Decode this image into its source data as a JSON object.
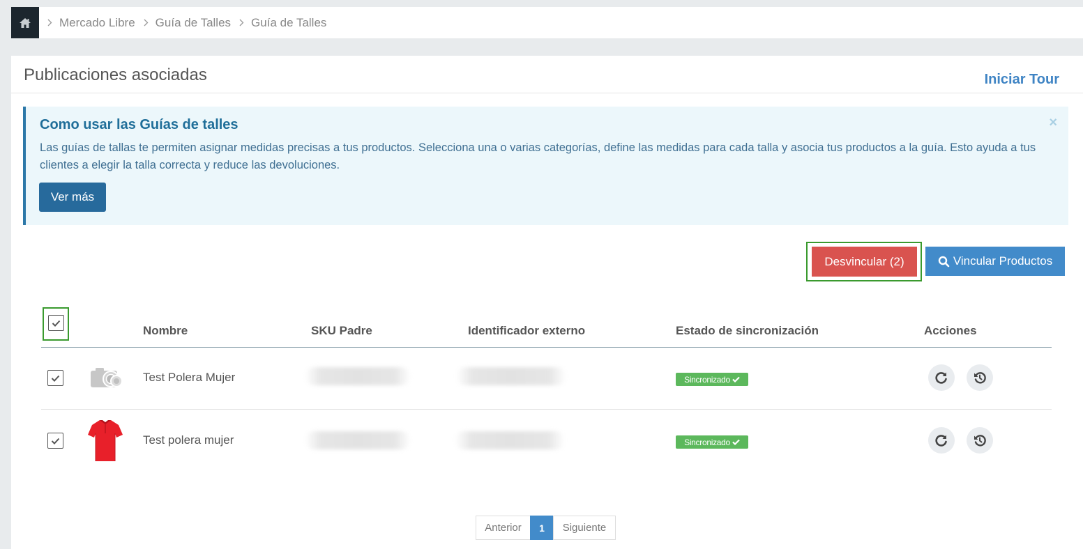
{
  "breadcrumb": {
    "home_icon": "home-icon",
    "items": [
      "Mercado Libre",
      "Guía de Talles",
      "Guía de Talles"
    ]
  },
  "panel": {
    "title": "Publicaciones asociadas",
    "tour_label": "Iniciar Tour"
  },
  "alert": {
    "title": "Como usar las Guías de talles",
    "body": "Las guías de tallas te permiten asignar medidas precisas a tus productos. Selecciona una o varias categorías, define las medidas para cada talla y asocia tus productos a la guía. Esto ayuda a tus clientes a elegir la talla correcta y reduce las devoluciones.",
    "button_label": "Ver más",
    "close_symbol": "×"
  },
  "actions": {
    "unlink_label": "Desvincular (2)",
    "link_label": "Vincular Productos"
  },
  "table": {
    "headers": {
      "name": "Nombre",
      "sku": "SKU Padre",
      "external_id": "Identificador externo",
      "sync_status": "Estado de sincronización",
      "actions": "Acciones"
    },
    "rows": [
      {
        "name": "Test Polera Mujer",
        "status": "Sincronizado",
        "image": "camera-placeholder-icon",
        "checked": true
      },
      {
        "name": "Test polera mujer",
        "status": "Sincronizado",
        "image": "red-polo-shirt",
        "checked": true
      }
    ]
  },
  "pagination": {
    "prev": "Anterior",
    "current": "1",
    "next": "Siguiente"
  },
  "colors": {
    "primary": "#428bca",
    "danger": "#d9534f",
    "success": "#5cb85c",
    "highlight": "#3a9a2e",
    "alert_bg": "#ecf7fb"
  }
}
